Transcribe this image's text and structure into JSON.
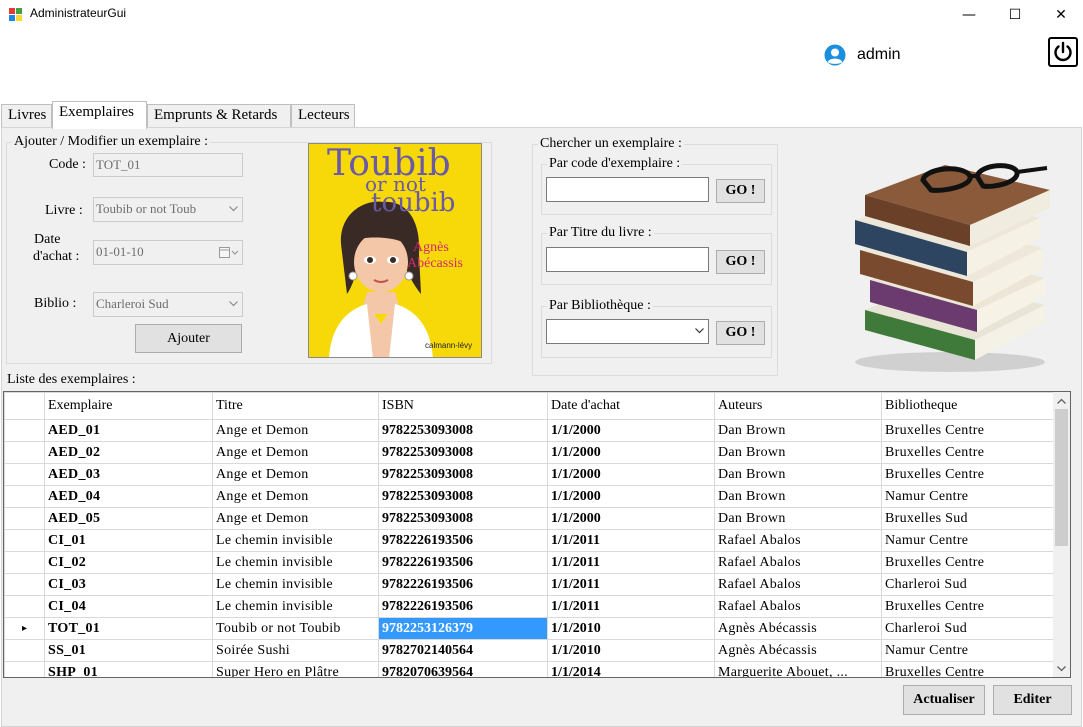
{
  "window": {
    "title": "AdministrateurGui",
    "minimize_glyph": "—",
    "maximize_glyph": "☐",
    "close_glyph": "✕"
  },
  "header": {
    "user": "admin",
    "user_icon": "user-circle-icon",
    "power_icon": "power-icon"
  },
  "tabs": [
    {
      "label": "Livres",
      "active": false
    },
    {
      "label": "Exemplaires",
      "active": true
    },
    {
      "label": "Emprunts & Retards",
      "active": false
    },
    {
      "label": "Lecteurs",
      "active": false
    }
  ],
  "form": {
    "legend": "Ajouter / Modifier  un exemplaire :",
    "code_label": "Code :",
    "code_value": "TOT_01",
    "livre_label": "Livre :",
    "livre_value": "Toubib or not Toub",
    "date_label_1": "Date",
    "date_label_2": "d'achat :",
    "date_value": "01-01-10",
    "biblio_label": "Biblio  :",
    "biblio_value": "Charleroi Sud",
    "add_button": "Ajouter"
  },
  "cover": {
    "title_1": "Toubib",
    "title_2": "or not",
    "title_3": "toubib",
    "author_1": "Agnès",
    "author_2": "Abécassis",
    "publisher": "calmann-lévy",
    "bg_color": "#f7d90a"
  },
  "search": {
    "legend": "Chercher  un exemplaire :",
    "by_code_legend": "Par code d'exemplaire :",
    "by_title_legend": "Par Titre du livre :",
    "by_library_legend": "Par Bibliothèque :",
    "go_label": "GO !"
  },
  "list": {
    "label": "Liste des exemplaires :",
    "columns": [
      "Exemplaire",
      "Titre",
      "ISBN",
      "Date d'achat",
      "Auteurs",
      "Bibliotheque"
    ],
    "rows": [
      [
        "AED_01",
        "Ange et Demon",
        "9782253093008",
        "1/1/2000",
        "Dan Brown",
        "Bruxelles Centre"
      ],
      [
        "AED_02",
        "Ange et Demon",
        "9782253093008",
        "1/1/2000",
        "Dan Brown",
        "Bruxelles Centre"
      ],
      [
        "AED_03",
        "Ange et Demon",
        "9782253093008",
        "1/1/2000",
        "Dan Brown",
        "Bruxelles Centre"
      ],
      [
        "AED_04",
        "Ange et Demon",
        "9782253093008",
        "1/1/2000",
        "Dan Brown",
        "Namur Centre"
      ],
      [
        "AED_05",
        "Ange et Demon",
        "9782253093008",
        "1/1/2000",
        "Dan Brown",
        "Bruxelles Sud"
      ],
      [
        "CI_01",
        "Le chemin invisible",
        "9782226193506",
        "1/1/2011",
        "Rafael Abalos",
        "Namur Centre"
      ],
      [
        "CI_02",
        "Le chemin invisible",
        "9782226193506",
        "1/1/2011",
        "Rafael Abalos",
        "Bruxelles Centre"
      ],
      [
        "CI_03",
        "Le chemin invisible",
        "9782226193506",
        "1/1/2011",
        "Rafael Abalos",
        "Charleroi Sud"
      ],
      [
        "CI_04",
        "Le chemin invisible",
        "9782226193506",
        "1/1/2011",
        "Rafael Abalos",
        "Bruxelles Centre"
      ],
      [
        "TOT_01",
        "Toubib or not Toubib",
        "9782253126379",
        "1/1/2010",
        "Agnès Abécassis",
        "Charleroi Sud"
      ],
      [
        "SS_01",
        "Soirée Sushi",
        "9782702140564",
        "1/1/2010",
        "Agnès Abécassis",
        "Namur Centre"
      ],
      [
        "SHP_01",
        "Super Hero en Plâtre",
        "9782070639564",
        "1/1/2014",
        "Marguerite Abouet,  ...",
        "Bruxelles Centre"
      ]
    ],
    "current_row_index": 9,
    "current_row_marker": "▸",
    "selected_cell": "ISBN"
  },
  "footer": {
    "refresh_button": "Actualiser",
    "edit_button": "Editer"
  }
}
